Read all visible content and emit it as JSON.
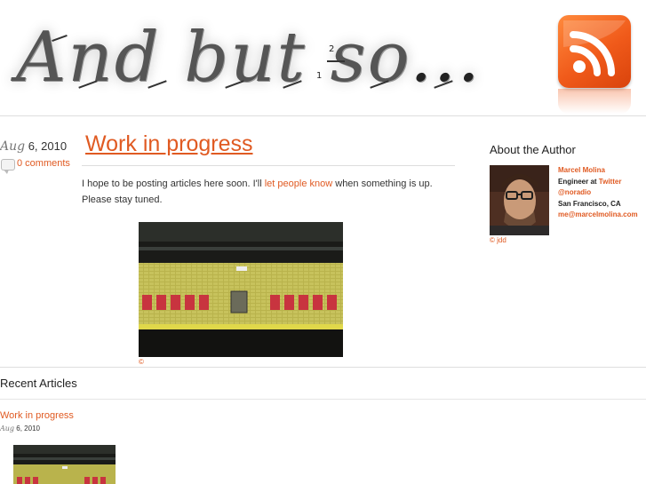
{
  "header": {
    "logo_part1": "And but so",
    "logo_part2": "...",
    "stroke_num_1": "1",
    "stroke_num_2": "2",
    "rss_icon": "rss-feed-icon",
    "colors": {
      "rss": "#f05a1a"
    }
  },
  "post": {
    "date_month": "Aug",
    "date_rest": " 6, 2010",
    "comments_label": "0 comments",
    "title": "Work in progress",
    "body_before": "I hope to be posting articles here soon. I'll ",
    "body_link": "let people know",
    "body_after": " when something is up. Please stay tuned.",
    "photo_credit": "©"
  },
  "sidebar": {
    "heading": "About the Author",
    "photo_credit": "© jdd",
    "name": "Marcel Molina",
    "role_prefix": "Engineer at ",
    "role_link": "Twitter",
    "handle": "@noradio",
    "location": "San Francisco, CA",
    "email": "me@marcelmolina.com"
  },
  "recent": {
    "heading": "Recent Articles",
    "items": [
      {
        "title": "Work in progress",
        "date_month": "Aug",
        "date_rest": " 6, 2010"
      }
    ]
  },
  "colors": {
    "accent": "#e05a22",
    "rule": "#dedede"
  }
}
